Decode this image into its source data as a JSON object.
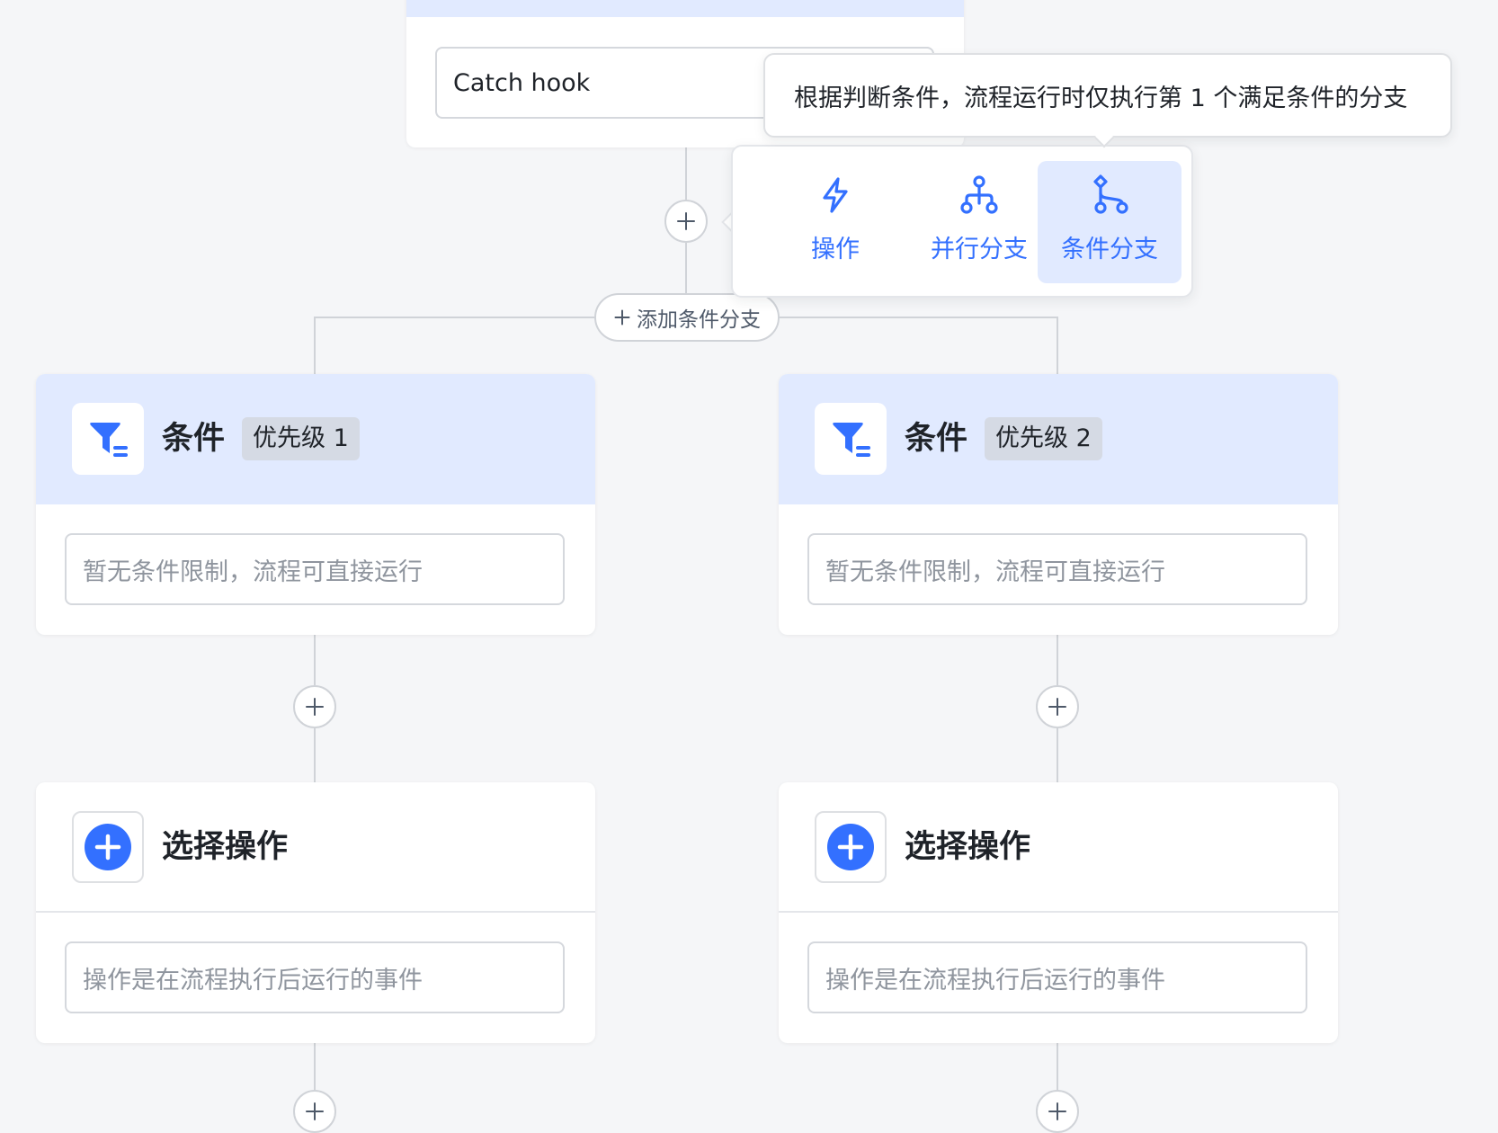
{
  "trigger_card": {
    "input_value": "Catch hook"
  },
  "tooltip": {
    "text": "根据判断条件，流程运行时仅执行第 1 个满足条件的分支"
  },
  "branch_menu": {
    "options": [
      {
        "label": "操作",
        "icon": "lightning-icon"
      },
      {
        "label": "并行分支",
        "icon": "parallel-branch-icon"
      },
      {
        "label": "条件分支",
        "icon": "condition-branch-icon",
        "selected": true
      }
    ]
  },
  "add_condition_branch": {
    "label": "添加条件分支"
  },
  "branches": [
    {
      "condition": {
        "title": "条件",
        "priority": "优先级 1",
        "placeholder": "暂无条件限制，流程可直接运行"
      },
      "action": {
        "title": "选择操作",
        "placeholder": "操作是在流程执行后运行的事件"
      }
    },
    {
      "condition": {
        "title": "条件",
        "priority": "优先级 2",
        "placeholder": "暂无条件限制，流程可直接运行"
      },
      "action": {
        "title": "选择操作",
        "placeholder": "操作是在流程执行后运行的事件"
      }
    }
  ],
  "colors": {
    "accent": "#3370ff",
    "accent_light": "#e1eaff",
    "background": "#f5f6f8",
    "connector": "#d0d3d8"
  }
}
